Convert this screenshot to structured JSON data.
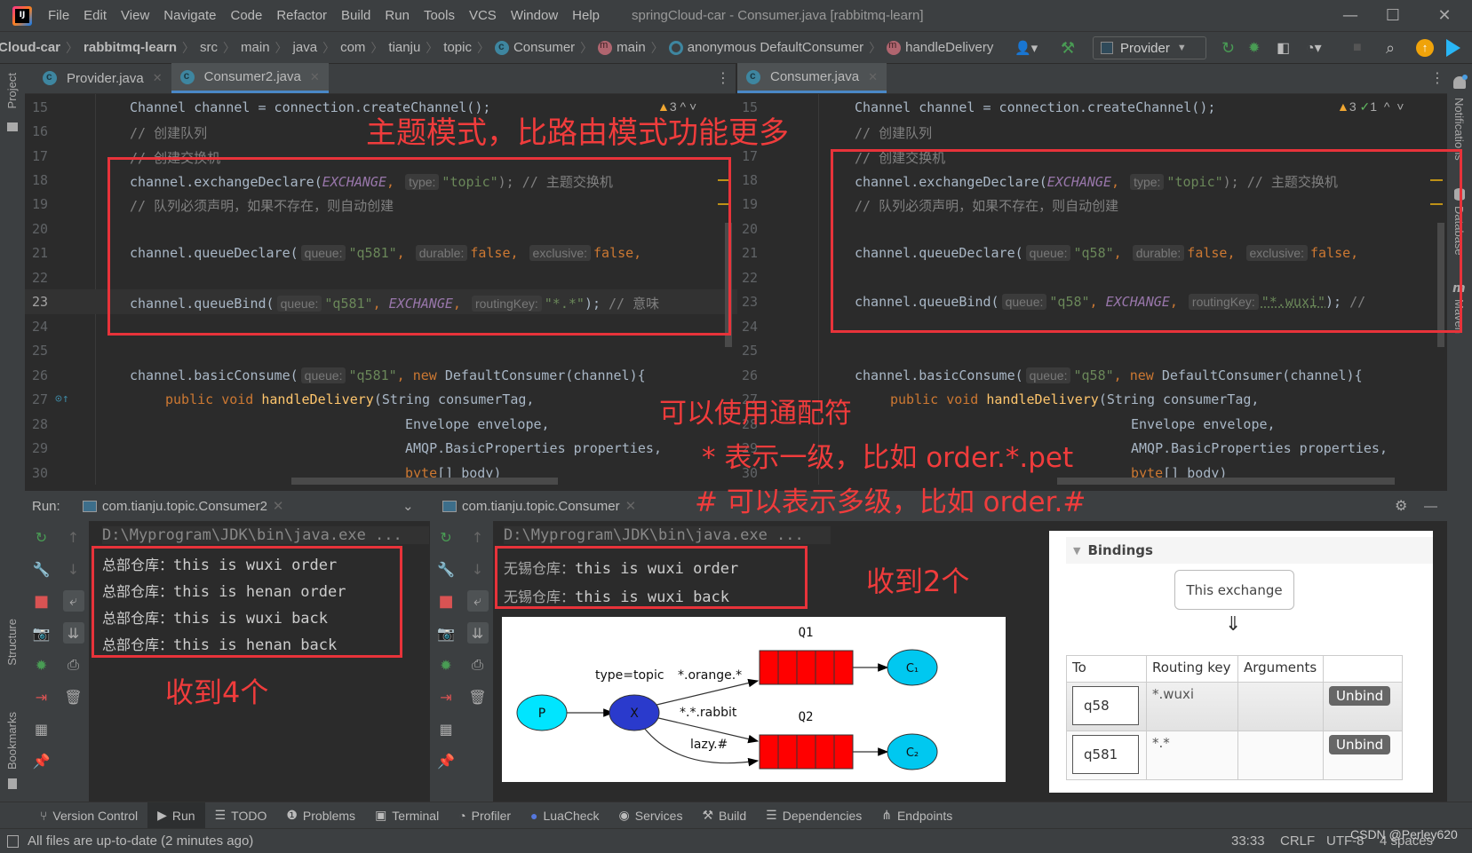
{
  "menubar": {
    "items": [
      "File",
      "Edit",
      "View",
      "Navigate",
      "Code",
      "Refactor",
      "Build",
      "Run",
      "Tools",
      "VCS",
      "Window",
      "Help"
    ],
    "title": "springCloud-car - Consumer.java [rabbitmq-learn]",
    "minimize": "—",
    "maximize": "☐",
    "close": "✕"
  },
  "navbar": {
    "crumbs": [
      "Cloud-car",
      "rabbitmq-learn",
      "src",
      "main",
      "java",
      "com",
      "tianju",
      "topic",
      "Consumer",
      "main",
      "anonymous DefaultConsumer",
      "handleDelivery"
    ],
    "run_config": "Provider"
  },
  "left_editor": {
    "tabs": [
      {
        "label": "Provider.java"
      },
      {
        "label": "Consumer2.java",
        "active": true
      }
    ],
    "inspection": {
      "warnings": "3"
    },
    "queue": "\"q581\"",
    "routing_key": "\"*.*\"",
    "trailing_comment": "// 意味",
    "lines": [
      "15",
      "16",
      "17",
      "18",
      "19",
      "20",
      "21",
      "22",
      "23",
      "24",
      "25",
      "26",
      "27",
      "28",
      "29",
      "30"
    ]
  },
  "right_editor": {
    "tabs": [
      {
        "label": "Consumer.java",
        "active": true
      }
    ],
    "inspection": {
      "warnings": "3",
      "ok": "1"
    },
    "queue": "\"q58\"",
    "routing_key": "\"*.wuxi\"",
    "lines": [
      "15",
      "16",
      "17",
      "18",
      "19",
      "20",
      "21",
      "22",
      "23",
      "24",
      "25",
      "26",
      "27",
      "28",
      "29",
      "30"
    ]
  },
  "code": {
    "l15": "Channel channel = connection.createChannel();",
    "l16": "// 创建队列",
    "l17": "// 创建交换机",
    "l18a": "channel.exchangeDeclare(",
    "l18b": "EXCHANGE",
    "hint_type": "type:",
    "l18c": "\"topic\"",
    "l18d": "); // 主题交换机",
    "l19": "// 队列必须声明，如果不存在，则自动创建",
    "l21a": "channel.queueDeclare(",
    "hint_queue": "queue:",
    "hint_durable": "durable:",
    "hint_exclusive": "exclusive:",
    "false": "false",
    "l23a": "channel.queueBind(",
    "hint_rk": "routingKey:",
    "l26a": "channel.basicConsume(",
    "new_kw": "new",
    "l26b": " DefaultConsumer(channel){",
    "l27a": "public void ",
    "l27b": "handleDelivery",
    "l27c": "(String consumerTag,",
    "l28": "Envelope envelope,",
    "l29": "AMQP.BasicProperties properties,",
    "l30a": "byte",
    "l30b": "[] body)"
  },
  "annotations": {
    "title": "主题模式，比路由模式功能更多",
    "wildcard": "可以使用通配符",
    "star": "* 表示一级，比如 order.*.pet",
    "hash": "# 可以表示多级，比如 order.#",
    "recv4": "收到4个",
    "recv2": "收到2个"
  },
  "run_panel": {
    "label": "Run:",
    "left_tab": "com.tianju.topic.Consumer2",
    "right_tab": "com.tianju.topic.Consumer",
    "cmd": "D:\\Myprogram\\JDK\\bin\\java.exe ...",
    "left_output": [
      {
        "prefix": "总部仓库：",
        "msg": "this is wuxi order"
      },
      {
        "prefix": "总部仓库：",
        "msg": "this is henan order"
      },
      {
        "prefix": "总部仓库：",
        "msg": "this is wuxi back"
      },
      {
        "prefix": "总部仓库：",
        "msg": "this is henan back"
      }
    ],
    "right_output": [
      {
        "prefix": "无锡仓库：",
        "msg": "this is wuxi order"
      },
      {
        "prefix": "无锡仓库：",
        "msg": "this is wuxi back"
      }
    ]
  },
  "diagram": {
    "type_label": "type=topic",
    "producer": "P",
    "exchange": "X",
    "q1": "Q1",
    "q2": "Q2",
    "c1": "C₁",
    "c2": "C₂",
    "key1": "*.orange.*",
    "key2": "*.*.rabbit",
    "key3": "lazy.#"
  },
  "bindings": {
    "title": "Bindings",
    "this_exchange": "This exchange",
    "arrow": "⇓",
    "headers": [
      "To",
      "Routing key",
      "Arguments",
      ""
    ],
    "rows": [
      {
        "to": "q58",
        "key": "*.wuxi",
        "args": "",
        "action": "Unbind"
      },
      {
        "to": "q581",
        "key": "*.*",
        "args": "",
        "action": "Unbind"
      }
    ]
  },
  "side_labels": {
    "project": "Project",
    "structure": "Structure",
    "bookmarks": "Bookmarks",
    "notifications": "Notifications",
    "database": "Database",
    "maven": "Maven"
  },
  "bottom_tools": [
    "Version Control",
    "Run",
    "TODO",
    "Problems",
    "Terminal",
    "Profiler",
    "LuaCheck",
    "Services",
    "Build",
    "Dependencies",
    "Endpoints"
  ],
  "status": {
    "message": "All files are up-to-date (2 minutes ago)",
    "position": "33:33",
    "line_sep": "CRLF",
    "encoding": "UTF-8",
    "indent": "4 spaces",
    "watermark": "CSDN @Perley620"
  }
}
